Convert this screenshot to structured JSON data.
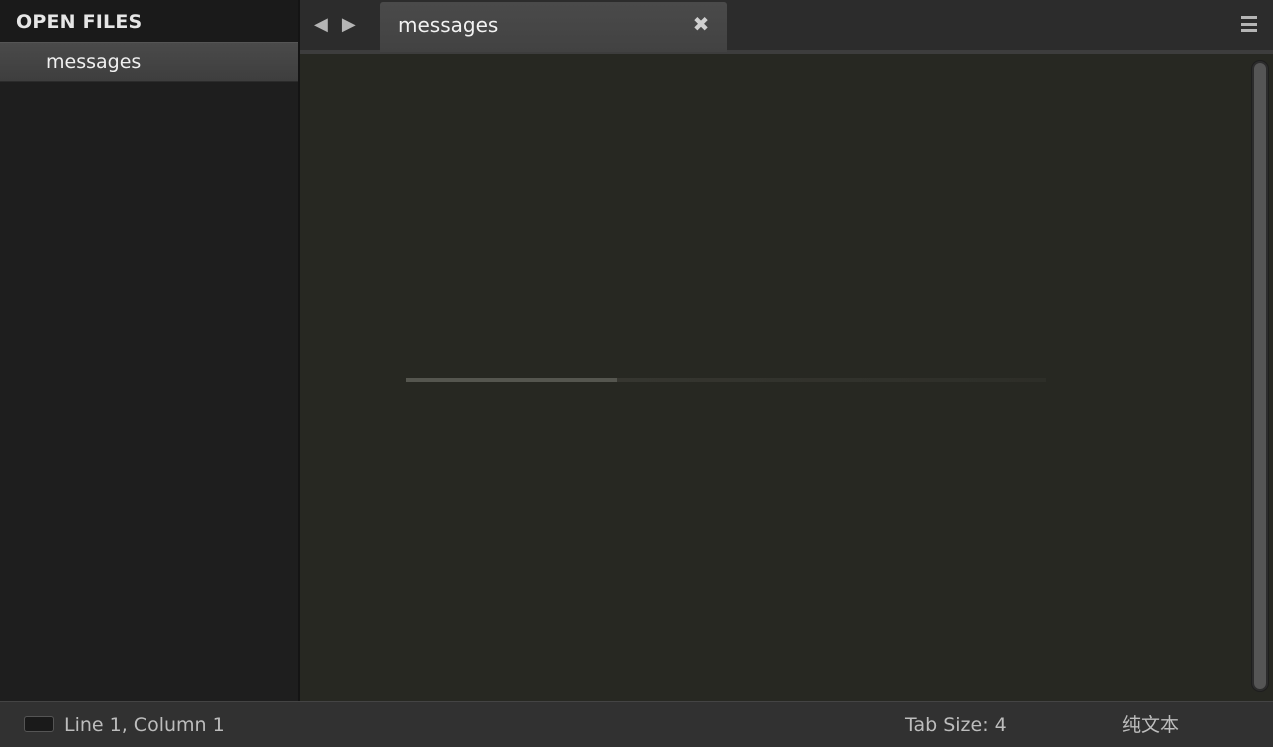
{
  "sidebar": {
    "header": "OPEN FILES",
    "items": [
      {
        "label": "messages"
      }
    ]
  },
  "tabbar": {
    "nav_back": "◀",
    "nav_forward": "▶",
    "tabs": [
      {
        "label": "messages",
        "close": "✖"
      }
    ],
    "menu_icon": "hamburger-menu-icon"
  },
  "editor": {
    "loading_progress": 0.33
  },
  "statusbar": {
    "position": "Line 1, Column 1",
    "tab_size": "Tab Size: 4",
    "syntax": "纯文本",
    "panel_icon": "panel-toggle-icon"
  },
  "colors": {
    "editor_bg": "#272822",
    "sidebar_bg": "#1e1e1e",
    "tab_active": "#4a4a4a",
    "statusbar_bg": "#313131"
  }
}
